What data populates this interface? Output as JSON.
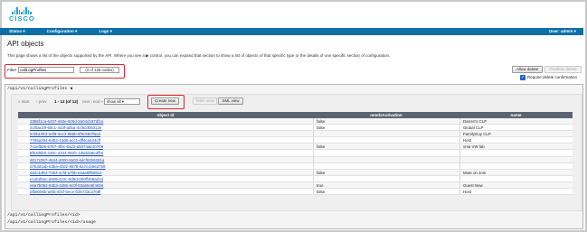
{
  "brand": {
    "name": "CISCO"
  },
  "menubar": {
    "items": [
      {
        "label": "Status ▾"
      },
      {
        "label": "Configuration ▾"
      },
      {
        "label": "Logs ▾"
      }
    ],
    "user": "User: admin ▾"
  },
  "page": {
    "title": "API objects",
    "description": "This page shows a list of the objects supported by the API. Where you see a ▶ control, you can expand that section to show a list of objects of that specific type or the details of one specific section of configuration."
  },
  "filter": {
    "label": "Filter",
    "value": "callLogProfiles",
    "count": "(3 of 126 nodes)"
  },
  "actions": {
    "allow_delete": "Allow delete",
    "disallow_delete": "Disallow delete",
    "require_delete_confirmation": "Require delete confirmation"
  },
  "section": {
    "path": "/api/v1/callingProfiles ◀",
    "pager_start": "« start",
    "pager_prev": "‹ prev",
    "pager_range": "1 - 12 (of 12)",
    "pager_next": "next ›",
    "pager_end": "end »",
    "per_page": "show all",
    "create_new": "Create new",
    "table_view": "Table view",
    "xml_view": "XML view"
  },
  "table": {
    "columns": [
      "object id",
      "needsActivation",
      "name"
    ],
    "rows": [
      {
        "id": "3355f1ca-6437-463e-925d-2a04d187df1a",
        "needsActivation": "false",
        "name": "Darren's CLP"
      },
      {
        "id": "41f5ac29-60c1-443f-ab5a-4cf5cd05012e",
        "needsActivation": "false",
        "name": "Global CLP"
      },
      {
        "id": "5cbb10b3-a4f8-4ec3-888b-6f9c55cffaa3",
        "needsActivation": "",
        "name": "FamilyGuy CLP"
      },
      {
        "id": "7755a294-6452-43d8-acc1-dff4ca444cff",
        "needsActivation": "",
        "name": "Host"
      },
      {
        "id": "7c1ef505-5767-4fbc-ba22-a9374ab10709",
        "needsActivation": "false",
        "name": "vma VW lab"
      },
      {
        "id": "8f53d5b0-160c-4344-992b-1d5dda8e4fb0",
        "needsActivation": "",
        "name": ""
      },
      {
        "id": "d017c057-4644-4000-8a03-6dcf63b6281a",
        "needsActivation": "",
        "name": ""
      },
      {
        "id": "d753d1ab-53ba-40d2-8578-8a7ccb56d759",
        "needsActivation": "",
        "name": ""
      },
      {
        "id": "da2c1db4-7264-4cfd-a75b-eaaa6ff669c2",
        "needsActivation": "false",
        "name": "Mute on Join"
      },
      {
        "id": "e1abd5ac-a509-422c-8d8d-0b0ff456ad1d",
        "needsActivation": "",
        "name": ""
      },
      {
        "id": "e6a7b052-83b3-4d55-9c0f-63a5546f4656",
        "needsActivation": "true",
        "name": "Guest New"
      },
      {
        "id": "ef58006b-a6fa-40cf-bece-b35733ca768f",
        "needsActivation": "false",
        "name": "Host"
      }
    ]
  },
  "footer_paths": [
    "/api/v1/callingProfiles/<id>",
    "/api/v1/callingProfiles/<id>/usage"
  ],
  "colors": {
    "menubar": "#0c6fa8",
    "brand": "#1ba0d7",
    "highlight": "#d9282d",
    "table_header": "#5a6473",
    "link": "#1a4fbf"
  }
}
